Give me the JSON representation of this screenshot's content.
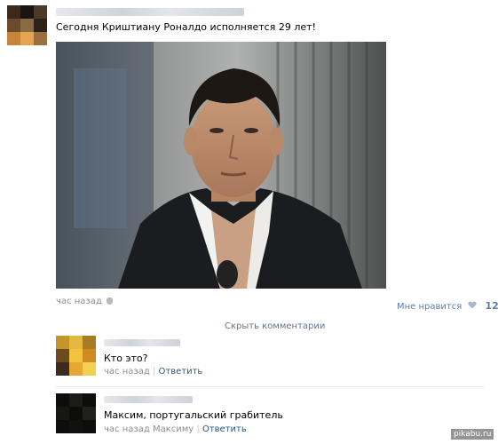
{
  "post": {
    "text": "Сегодня Криштиану Роналдо исполняется 29 лет!",
    "time": "час назад",
    "like_label": "Мне нравится",
    "like_count": "12"
  },
  "comments_toggle": "Скрыть комментарии",
  "comments": [
    {
      "text": "Кто это?",
      "time": "час назад",
      "reply": "Ответить"
    },
    {
      "text": "Максим, португальский грабитель",
      "time": "час назад",
      "reply_to": "Максиму",
      "reply": "Ответить"
    }
  ],
  "watermark": "pikabu.ru",
  "colors": {
    "link": "#2b587a",
    "like": "#5b7fa6",
    "meta": "#8a8f96"
  }
}
